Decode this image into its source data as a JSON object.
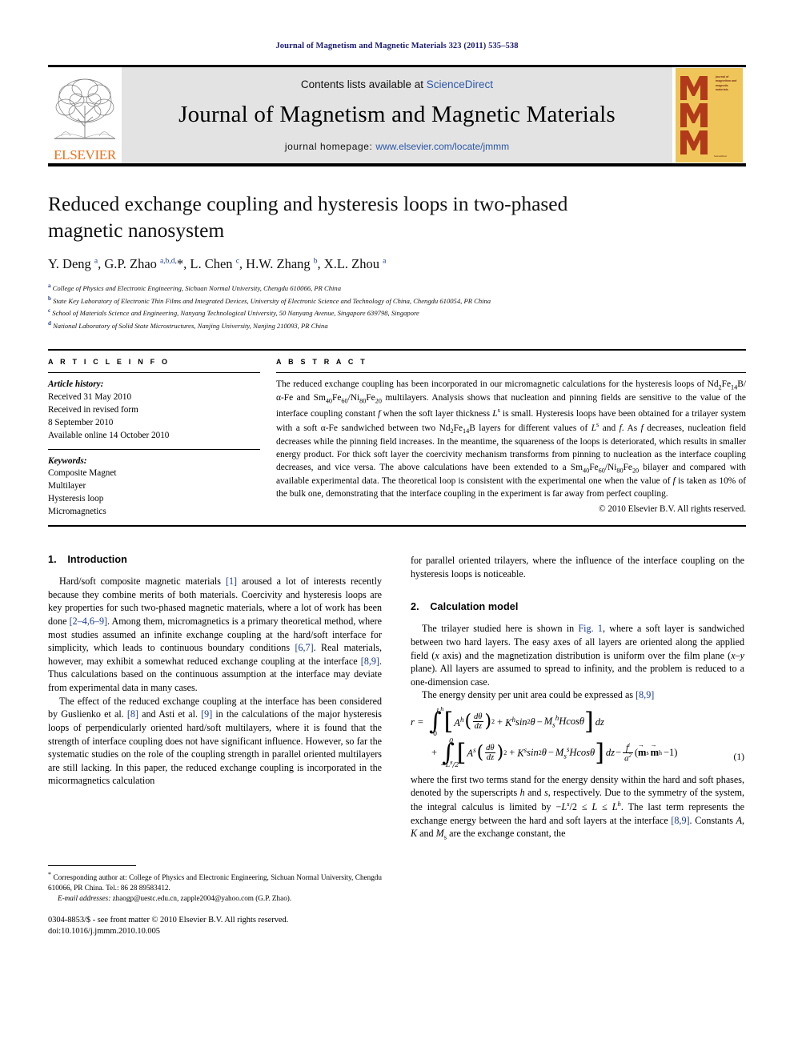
{
  "running_head": "Journal of Magnetism and Magnetic Materials 323 (2011) 535–538",
  "masthead": {
    "contents_prefix": "Contents lists available at",
    "contents_link": "ScienceDirect",
    "journal_title": "Journal of Magnetism and Magnetic Materials",
    "homepage_prefix": "journal homepage:",
    "homepage_url": "www.elsevier.com/locate/jmmm",
    "publisher_wordmark": "ELSEVIER",
    "cover_title_lines": "journal of magnetism and magnetic materials",
    "cover_letters": "MMM",
    "colors": {
      "link_blue": "#2a57a8",
      "elsevier_orange": "#E9711C",
      "cover_background": "#EFC55A",
      "cover_letters": "#B03A1A",
      "band_gray": "#e3e3e3"
    }
  },
  "article": {
    "title": "Reduced exchange coupling and hysteresis loops in two-phased magnetic nanosystem",
    "authors_html": "Y. Deng <sup>a</sup>, G.P. Zhao <sup>a,b,d,</sup><span class=\"star\">*</span>, L. Chen <sup>c</sup>, H.W. Zhang <sup>b</sup>, X.L. Zhou <sup>a</sup>",
    "affiliations": [
      {
        "mark": "a",
        "text": "College of Physics and Electronic Engineering, Sichuan Normal University, Chengdu 610066, PR China"
      },
      {
        "mark": "b",
        "text": "State Key Laboratory of Electronic Thin Films and Integrated Devices, University of Electronic Science and Technology of China, Chengdu 610054, PR China"
      },
      {
        "mark": "c",
        "text": "School of Materials Science and Engineering, Nanyang Technological University, 50 Nanyang Avenue, Singapore 639798, Singapore"
      },
      {
        "mark": "d",
        "text": "National Laboratory of Solid State Microstructures, Nanjing University, Nanjing 210093, PR China"
      }
    ]
  },
  "info_section": {
    "heading_info": "A R T I C L E   I N F O",
    "heading_abstract": "A B S T R A C T",
    "history_label": "Article history:",
    "history_lines": [
      "Received 31 May 2010",
      "Received in revised form",
      "8 September 2010",
      "Available online 14 October 2010"
    ],
    "keywords_label": "Keywords:",
    "keywords": [
      "Composite Magnet",
      "Multilayer",
      "Hysteresis loop",
      "Micromagnetics"
    ]
  },
  "abstract": {
    "html": "The reduced exchange coupling has been incorporated in our micromagnetic calculations for the hysteresis loops of Nd<sub>2</sub>Fe<sub>14</sub>B/&#945;-Fe and Sm<sub>40</sub>Fe<sub>60</sub>/Ni<sub>80</sub>Fe<sub>20</sub> multilayers. Analysis shows that nucleation and pinning fields are sensitive to the value of the interface coupling constant <i>f</i> when the soft layer thickness <i>L</i><sup class=\"s\">s</sup> is small. Hysteresis loops have been obtained for a trilayer system with a soft &#945;-Fe sandwiched between two Nd<sub>2</sub>Fe<sub>14</sub>B layers for different values of <i>L</i><sup class=\"s\">s</sup> and <i>f</i>. As <i>f</i> decreases, nucleation field decreases while the pinning field increases. In the meantime, the squareness of the loops is deteriorated, which results in smaller energy product. For thick soft layer the coercivity mechanism transforms from pinning to nucleation as the interface coupling decreases, and vice versa. The above calculations have been extended to a Sm<sub>40</sub>Fe<sub>60</sub>/Ni<sub>80</sub>Fe<sub>20</sub> bilayer and compared with available experimental data. The theoretical loop is consistent with the experimental one when the value of <i>f</i> is taken as 10% of the bulk one, demonstrating that the interface coupling in the experiment is far away from perfect coupling.",
    "copyright": "&#169; 2010 Elsevier B.V. All rights reserved."
  },
  "sections": {
    "intro": {
      "number": "1.",
      "title": "Introduction",
      "paragraphs_html": [
        "Hard/soft composite magnetic materials <a class=\"cite\" href=\"#\">[1]</a> aroused a lot of interests recently because they combine merits of both materials. Coercivity and hysteresis loops are key properties for such two-phased magnetic materials, where a lot of work has been done <a class=\"cite\" href=\"#\">[2&#8211;4,6&#8211;9]</a>. Among them, micromagnetics is a primary theoretical method, where most studies assumed an infinite exchange coupling at the hard/soft interface for simplicity, which leads to continuous boundary conditions <a class=\"cite\" href=\"#\">[6,7]</a>. Real materials, however, may exhibit a somewhat reduced exchange coupling at the interface <a class=\"cite\" href=\"#\">[8,9]</a>. Thus calculations based on the continuous assumption at the interface may deviate from experimental data in many cases.",
        "The effect of the reduced exchange coupling at the interface has been considered by Guslienko et al. <a class=\"cite\" href=\"#\">[8]</a> and Asti et al. <a class=\"cite\" href=\"#\">[9]</a> in the calculations of the major hysteresis loops of perpendicularly oriented hard/soft multilayers, where it is found that the strength of interface coupling does not have significant influence. However, so far the systematic studies on the role of the coupling strength in parallel oriented multilayers are still lacking. In this paper, the reduced exchange coupling is incorporated in the micormagnetics calculation"
      ]
    },
    "intro_continued_html": "for parallel oriented trilayers, where the influence of the interface coupling on the hysteresis loops is noticeable.",
    "model": {
      "number": "2.",
      "title": "Calculation model",
      "paragraphs_html": [
        "The trilayer studied here is shown in <a class=\"cite\" href=\"#\">Fig. 1</a>, where a soft layer is sandwiched between two hard layers. The easy axes of all layers are oriented along the applied field (<i>x</i> axis) and the magnetization distribution is uniform over the film plane (<i>x</i>&#8211;<i>y</i> plane). All layers are assumed to spread to infinity, and the problem is reduced to a one-dimension case.",
        "The energy density per unit area could be expressed as <a class=\"cite\" href=\"#\">[8,9]</a>"
      ],
      "after_equation_html": "where the first two terms stand for the energy density within the hard and soft phases, denoted by the superscripts <i>h</i> and <i>s</i>, respectively. Due to the symmetry of the system, the integral calculus is limited by &#8722;<i>L<sup class=\"s\">s</sup></i>/2 &#8804; <i>L</i> &#8804; <i>L<sup class=\"s\">h</sup></i>. The last term represents the exchange energy between the hard and soft layers at the interface <a class=\"cite\" href=\"#\">[8,9]</a>. Constants <i>A</i>, <i>K</i> and <i>M</i><sub>s</sub> are the exchange constant, the"
    }
  },
  "equation": {
    "number": "(1)",
    "lhs": "r =",
    "int1_upper": "L",
    "int1_upper_sup": "h",
    "int1_lower": "0",
    "int1_body": "A^h (dθ/dz)^2 + K^h sin²θ − M_s^h H cosθ dz",
    "int2_upper": "0",
    "int2_lower": "−L^s/2",
    "int2_body": "A^s (dθ/dz)^2 + K^s sin²θ − M_s^s H cosθ dz",
    "last_term": "− (f/a²)(m^s · m^h − 1)"
  },
  "footnotes": {
    "corresponding_html": "<span class=\"star\">*</span> Corresponding author at: College of Physics and Electronic Engineering, Sichuan Normal University, Chengdu 610066, PR China. Tel.: 86 28 89583412.",
    "email_label": "E-mail addresses:",
    "email_html": "zhaogp@uestc.edu.cn, zapple2004@yahoo.com (G.P. Zhao)."
  },
  "imprint": {
    "line1_html": "0304-8853/$ - see front matter &#169; 2010 Elsevier B.V. All rights reserved.",
    "line2": "doi:10.1016/j.jmmm.2010.10.005"
  }
}
